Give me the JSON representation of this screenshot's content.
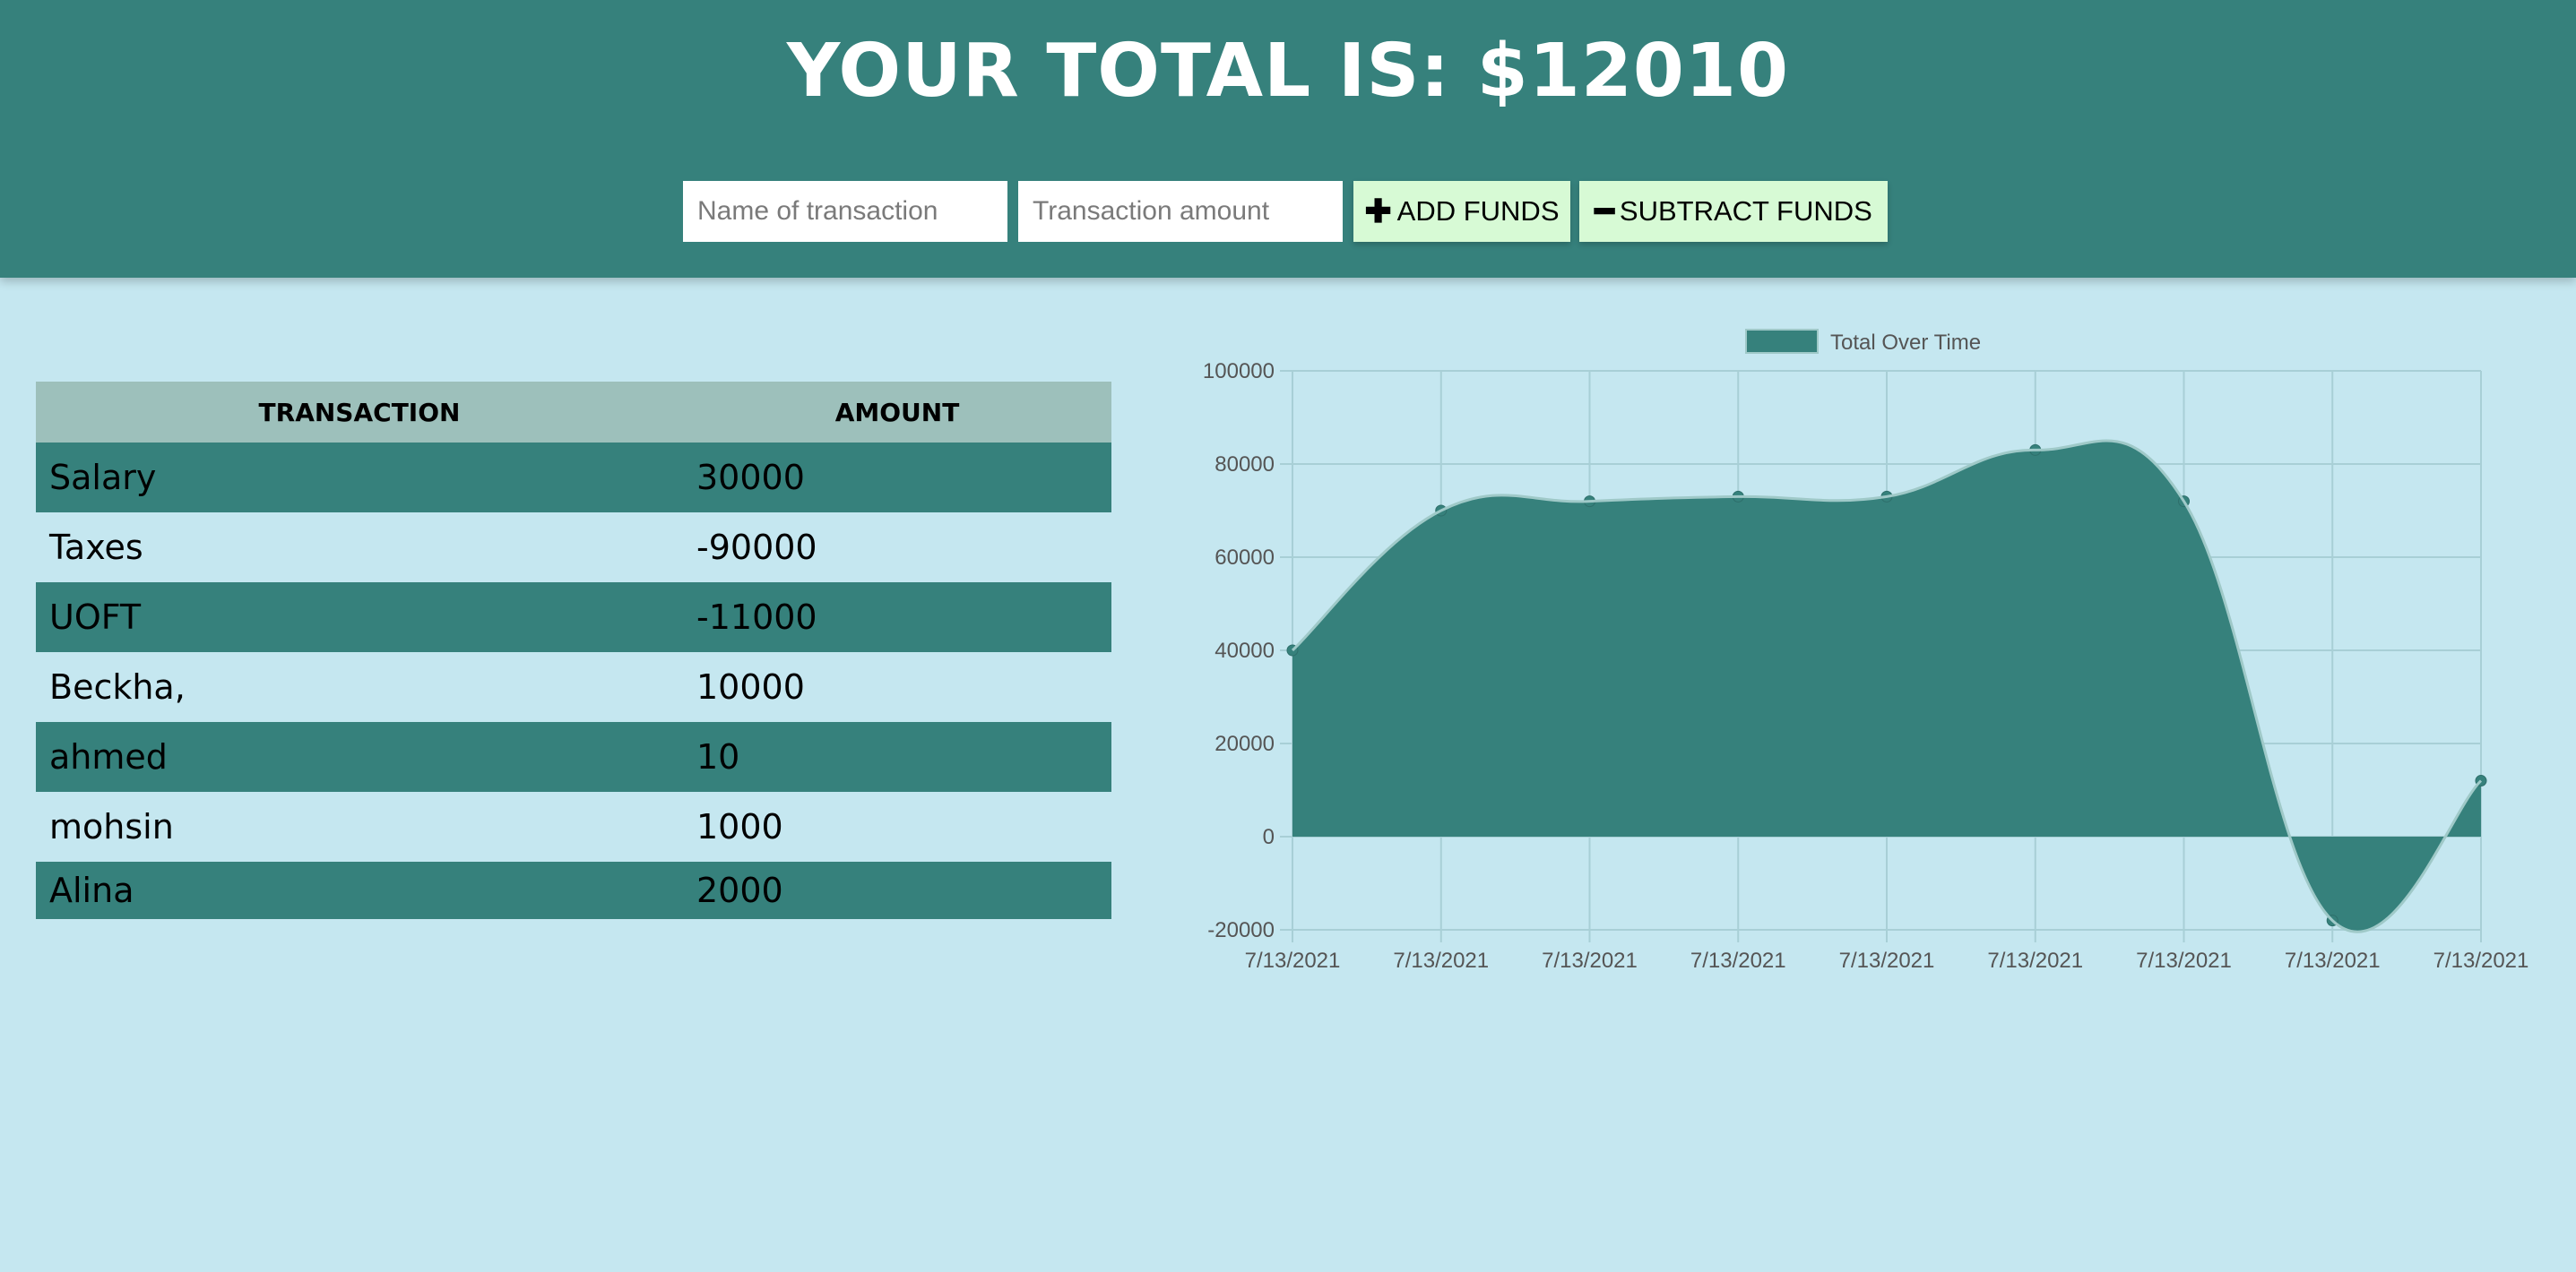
{
  "header": {
    "total_text": "YOUR TOTAL IS: $12010",
    "name_placeholder": "Name of transaction",
    "amount_placeholder": "Transaction amount",
    "add_label": "ADD FUNDS",
    "subtract_label": "SUBTRACT FUNDS",
    "add_icon": "plus-icon",
    "subtract_icon": "minus-icon"
  },
  "table": {
    "headers": [
      "TRANSACTION",
      "AMOUNT"
    ],
    "rows": [
      {
        "name": "Salary",
        "amount": "30000"
      },
      {
        "name": "Taxes",
        "amount": "-90000"
      },
      {
        "name": "UOFT",
        "amount": "-11000"
      },
      {
        "name": "Beckha,",
        "amount": "10000"
      },
      {
        "name": "ahmed",
        "amount": "10"
      },
      {
        "name": "mohsin",
        "amount": "1000"
      },
      {
        "name": "Alina",
        "amount": "2000"
      }
    ]
  },
  "colors": {
    "header_bg": "#36817c",
    "page_bg": "#c5e7f0",
    "button_bg": "#d7fad5",
    "table_header_bg": "#9dc0bb"
  },
  "chart_data": {
    "type": "area",
    "legend": "Total Over Time",
    "legend_position": "top",
    "x": [
      "7/13/2021",
      "7/13/2021",
      "7/13/2021",
      "7/13/2021",
      "7/13/2021",
      "7/13/2021",
      "7/13/2021",
      "7/13/2021",
      "7/13/2021"
    ],
    "series": [
      {
        "name": "Total Over Time",
        "values": [
          40000,
          70000,
          72000,
          73000,
          73000,
          83000,
          72000,
          -18000,
          12010
        ]
      }
    ],
    "ylim": [
      -20000,
      100000
    ],
    "yticks": [
      -20000,
      0,
      20000,
      40000,
      60000,
      80000,
      100000
    ],
    "grid": true,
    "fill_color": "#36817c"
  }
}
